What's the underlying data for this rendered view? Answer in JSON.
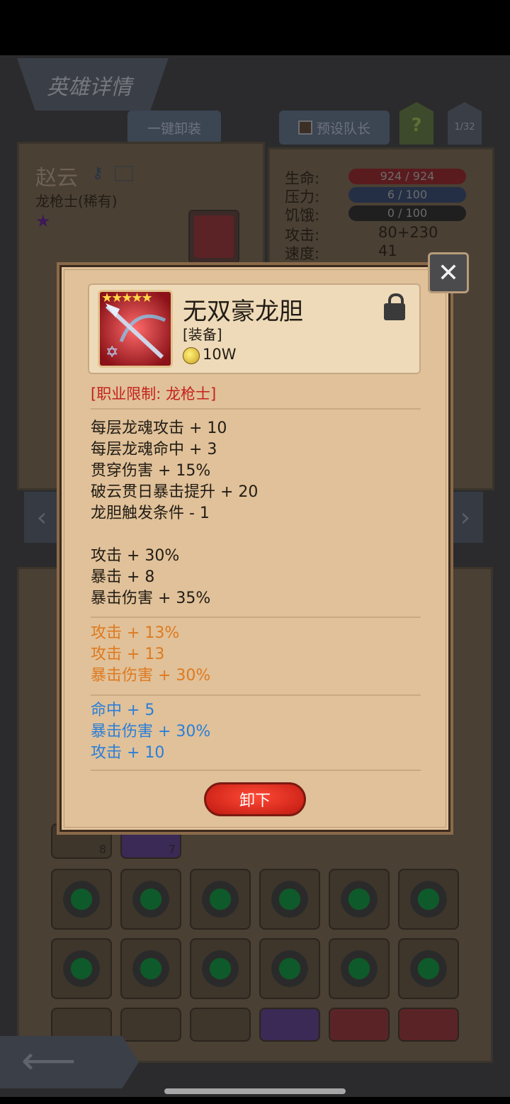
{
  "screen": {
    "title": "英雄详情",
    "tabs": {
      "unequip_all": "一键卸装",
      "preset_captain": "预设队长",
      "help": "?",
      "page": "1/32"
    }
  },
  "hero": {
    "name": "赵云",
    "class_label": "龙枪士(稀有)",
    "stats": [
      {
        "label": "生命:",
        "value": "924 / 924",
        "bar_color": "#7a1f22"
      },
      {
        "label": "压力:",
        "value": "6 / 100",
        "bar_color": "#2b3e63"
      },
      {
        "label": "饥饿:",
        "value": "0 / 100",
        "bar_color": "#2a2a2a"
      },
      {
        "label": "攻击:",
        "value": "80+230"
      },
      {
        "label": "速度:",
        "value": "41"
      }
    ]
  },
  "inventory": {
    "counts": [
      "8",
      "7"
    ]
  },
  "popup": {
    "item_name": "无双豪龙胆",
    "item_type": "[装备]",
    "item_price": "10W",
    "item_stars": "★★★★★",
    "item_symbol": "✡",
    "class_restriction": "[职业限制: 龙枪士]",
    "unique_effects": [
      "每层龙魂攻击 + 10",
      "每层龙魂命中 + 3",
      "贯穿伤害 + 15%",
      "破云贯日暴击提升 + 20",
      "龙胆触发条件 - 1"
    ],
    "base_stats": [
      "攻击 + 30%",
      "暴击 + 8",
      "暴击伤害 + 35%"
    ],
    "orange_stats": [
      "攻击 + 13%",
      "攻击 + 13",
      "暴击伤害 + 30%"
    ],
    "blue_stats": [
      "命中 + 5",
      "暴击伤害 + 30%",
      "攻击 + 10"
    ],
    "unequip_label": "卸下",
    "colors": {
      "restriction": "#c4211c",
      "normal": "#221c15",
      "orange": "#de7a20",
      "blue": "#2a7ed8"
    }
  }
}
